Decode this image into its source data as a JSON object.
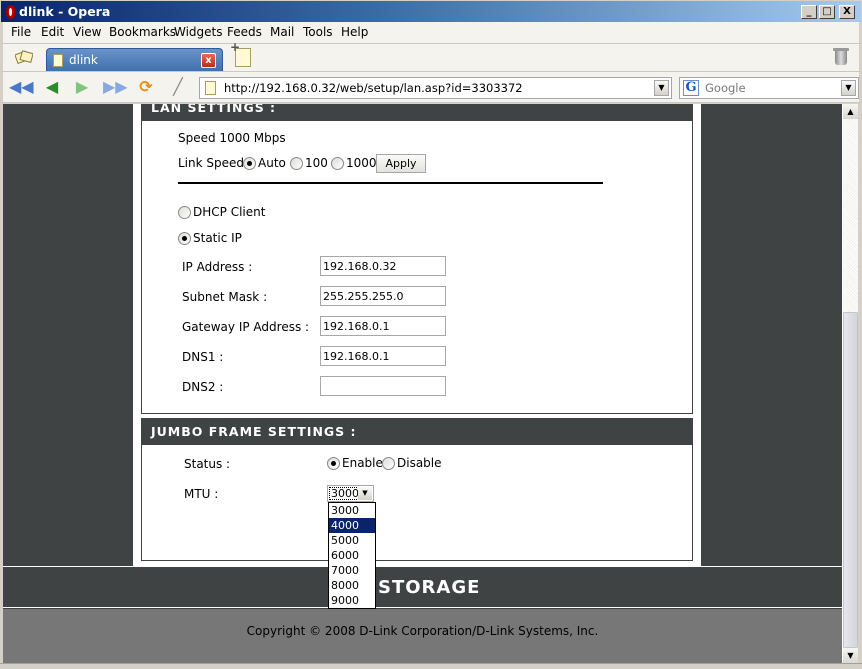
{
  "window": {
    "title": "dlink - Opera",
    "controls": {
      "minimize": "_",
      "maximize": "□",
      "close": "X"
    }
  },
  "menubar": {
    "items": [
      "File",
      "Edit",
      "View",
      "Bookmarks",
      "Widgets",
      "Feeds",
      "Mail",
      "Tools",
      "Help"
    ]
  },
  "tabs": {
    "active_tab": {
      "label": "dlink",
      "close": "x"
    }
  },
  "navbar": {
    "buttons": {
      "rewind": "◀◀",
      "back": "◀",
      "forward": "▶",
      "fast_forward": "▶▶",
      "reload": "⟳",
      "edit": "╱"
    },
    "url": "http://192.168.0.32/web/setup/lan.asp?id=3303372",
    "search_placeholder": "Google",
    "search_engine_icon": "G",
    "dropdown_arrow": "▼"
  },
  "lan_settings": {
    "header": "LAN SETTINGS :",
    "speed_text": "Speed 1000 Mbps",
    "link_speed_label": "Link Speed",
    "link_speed_options": [
      {
        "label": "Auto",
        "checked": true
      },
      {
        "label": "100",
        "checked": false
      },
      {
        "label": "1000",
        "checked": false
      }
    ],
    "apply_label": "Apply",
    "mode_options": [
      {
        "label": "DHCP Client",
        "checked": false
      },
      {
        "label": "Static IP",
        "checked": true
      }
    ],
    "fields": [
      {
        "label": "IP Address :",
        "value": "192.168.0.32"
      },
      {
        "label": "Subnet Mask :",
        "value": "255.255.255.0"
      },
      {
        "label": "Gateway IP Address :",
        "value": "192.168.0.1"
      },
      {
        "label": "DNS1 :",
        "value": "192.168.0.1"
      },
      {
        "label": "DNS2 :",
        "value": ""
      }
    ]
  },
  "jumbo_frame": {
    "header": "JUMBO FRAME SETTINGS :",
    "status_label": "Status :",
    "status_options": [
      {
        "label": "Enable",
        "checked": true
      },
      {
        "label": "Disable",
        "checked": false
      }
    ],
    "mtu_label": "MTU :",
    "mtu_selected": "3000",
    "mtu_options": [
      "3000",
      "4000",
      "5000",
      "6000",
      "7000",
      "8000",
      "9000"
    ],
    "mtu_highlighted": "4000"
  },
  "footer": {
    "brand": "STORAGE",
    "copyright": "Copyright © 2008 D-Link Corporation/D-Link Systems, Inc."
  },
  "scrollbar": {
    "up": "▲",
    "down": "▼"
  }
}
